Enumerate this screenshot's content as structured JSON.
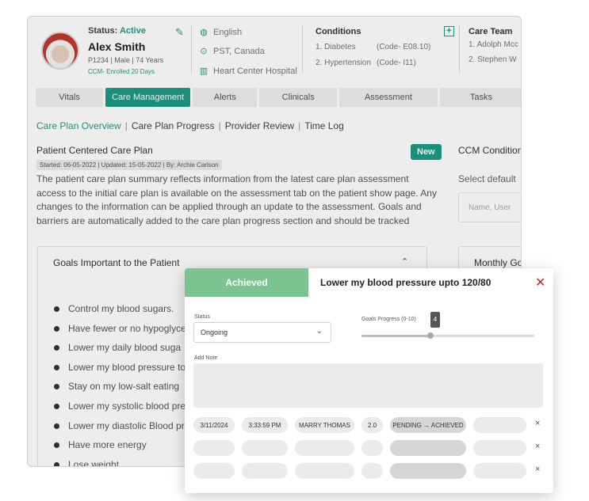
{
  "patient": {
    "status_label": "Status:",
    "status_value": "Active",
    "name": "Alex Smith",
    "meta": "P1234  |  Male  |  74 Years",
    "enrolled": "CCM- Enrolled 20 Days",
    "language": "English",
    "timezone": "PST, Canada",
    "hospital": "Heart Center Hospital"
  },
  "conditions": {
    "title": "Conditions",
    "items": [
      {
        "name": "1. Diabetes",
        "code": "(Code- E08.10)"
      },
      {
        "name": "2. Hypertension",
        "code": "(Code- I11)"
      }
    ]
  },
  "care_team": {
    "title": "Care Team",
    "members": [
      "1. Adolph Mcc",
      "2. Stephen W"
    ]
  },
  "tabs": [
    "Vitals",
    "Care Management",
    "Alerts",
    "Clinicals",
    "Assessment",
    "Tasks"
  ],
  "active_tab": "Care Management",
  "subnav": [
    "Care Plan Overview",
    "Care Plan Progress",
    "Provider Review",
    "Time Log"
  ],
  "plan": {
    "title": "Patient Centered Care Plan",
    "meta": "Started: 06-05-2022  |  Updated: 15-05-2022  |  By: Archie Carlson",
    "badge": "New",
    "description": "The patient care plan summary reflects information from the latest care plan assessment access to the initial care plan is available on the assessment tab on the patient show page. Any changes to the information can be applied through an update to the assessment. Goals and barriers are automatically added to the care plan progress section and should be tracked"
  },
  "ccm": {
    "title": "CCM Condition",
    "select_label": "Select default",
    "input_placeholder": "Name, User"
  },
  "goals": {
    "title": "Goals Important to the Patient",
    "items": [
      "Control my blood sugars.",
      "Have fewer or no hypoglyce",
      "Lower  my daily blood suga",
      "Lower my blood pressure to",
      "Stay on my low-salt eating",
      "Lower my systolic blood pre",
      "Lower my diastolic Blood pr",
      "Have more energy",
      "Lose weight"
    ]
  },
  "monthly": {
    "title": "Monthly Go"
  },
  "modal": {
    "status_tab": "Achieved",
    "title": "Lower my blood pressure upto 120/80",
    "status_label": "Status",
    "status_value": "Ongoing",
    "progress_label": "Goals Progress (0-10)",
    "progress_value": "4",
    "progress_fraction": 0.4,
    "note_label": "Add Note",
    "log": {
      "date": "3/11/2024",
      "time": "3:33:59 PM",
      "user": "MARRY THOMAS",
      "version": "2.0",
      "change": "PENDING → ACHIEVED"
    },
    "remove_glyph": "×"
  },
  "colors": {
    "accent": "#1f9a86",
    "achieved": "#7cc48f",
    "close": "#b03030"
  }
}
